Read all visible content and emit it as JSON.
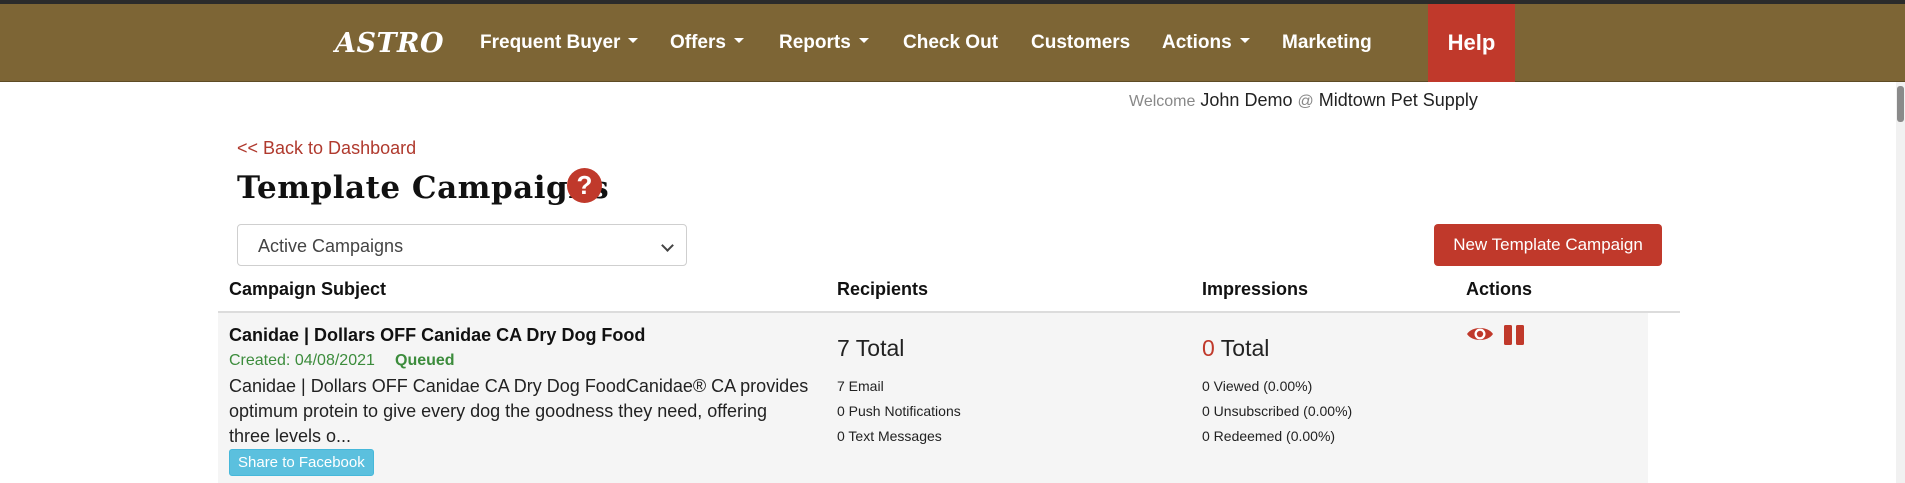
{
  "nav": {
    "logo": "ASTRO",
    "items": [
      {
        "label": "Frequent Buyer",
        "dropdown": true
      },
      {
        "label": "Offers",
        "dropdown": true
      },
      {
        "label": "Reports",
        "dropdown": true
      },
      {
        "label": "Check Out",
        "dropdown": false
      },
      {
        "label": "Customers",
        "dropdown": false
      },
      {
        "label": "Actions",
        "dropdown": true
      },
      {
        "label": "Marketing",
        "dropdown": false
      }
    ],
    "help_label": "Help"
  },
  "welcome": {
    "prefix": "Welcome",
    "user": "John Demo",
    "at": "@",
    "store": "Midtown Pet Supply"
  },
  "back_link": "<< Back to Dashboard",
  "page_title": "Template Campaigns",
  "help_icon_glyph": "?",
  "filter": {
    "selected": "Active Campaigns"
  },
  "new_button": "New Template Campaign",
  "table": {
    "headers": [
      "Campaign Subject",
      "Recipients",
      "Impressions",
      "Actions"
    ],
    "rows": [
      {
        "subject": "Canidae | Dollars OFF Canidae CA Dry Dog Food",
        "created": "Created: 04/08/2021",
        "status": "Queued",
        "description": "Canidae | Dollars OFF Canidae CA Dry Dog FoodCanidae® CA provides optimum protein to give every dog the goodness they need, offering three levels o...",
        "share_label": "Share to Facebook",
        "recipients_total_num": "7",
        "recipients_total_label": "Total",
        "recipients_email": "7 Email",
        "recipients_push": "0 Push Notifications",
        "recipients_text": "0 Text Messages",
        "impressions_total_num": "0",
        "impressions_total_label": "Total",
        "impressions_viewed": "0 Viewed (0.00%)",
        "impressions_unsubscribed": "0 Unsubscribed (0.00%)",
        "impressions_redeemed": "0 Redeemed (0.00%)",
        "actions": [
          "eye-icon",
          "pause-icon"
        ]
      }
    ]
  },
  "colors": {
    "navbar": "#7d6535",
    "accent": "#c0392b",
    "status_green": "#3c8c3c",
    "share_blue": "#5bc0de"
  }
}
